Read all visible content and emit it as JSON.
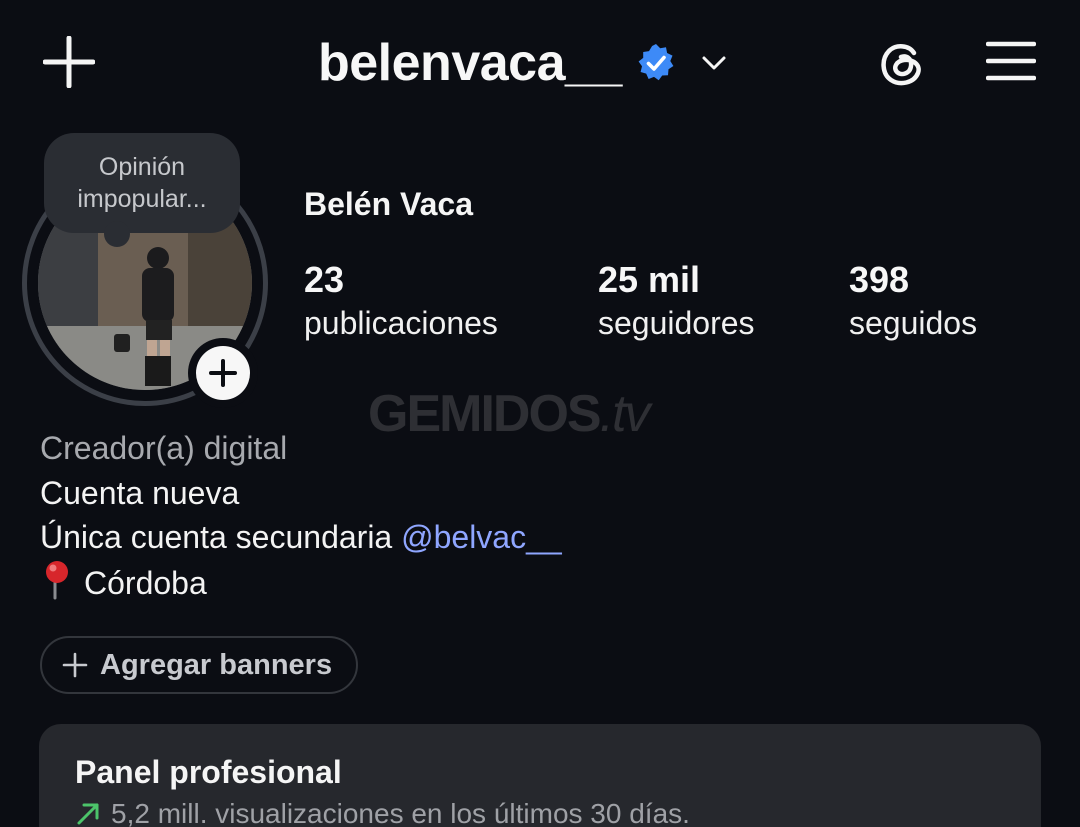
{
  "header": {
    "username": "belenvaca__",
    "icons": {
      "add": "plus-icon",
      "verified": "verified-badge-icon",
      "dropdown": "chevron-down-icon",
      "threads": "threads-icon",
      "menu": "hamburger-menu-icon"
    }
  },
  "note": {
    "text": "Opinión impopular..."
  },
  "profile": {
    "full_name": "Belén Vaca",
    "stats": [
      {
        "value": "23",
        "label": "publicaciones"
      },
      {
        "value": "25 mil",
        "label": "seguidores"
      },
      {
        "value": "398",
        "label": "seguidos"
      }
    ]
  },
  "watermark": {
    "brand": "GEMIDOS",
    "suffix": ".tv"
  },
  "bio": {
    "category": "Creador(a) digital",
    "line1": "Cuenta nueva",
    "line2_prefix": "Única cuenta secundaria ",
    "line2_mention": "@belvac__",
    "location": "Córdoba",
    "location_icon": "pushpin-icon"
  },
  "banner_button": {
    "label": "Agregar banners"
  },
  "panel": {
    "title": "Panel profesional",
    "subtitle": "5,2 mill. visualizaciones en los últimos 30 días."
  },
  "colors": {
    "background": "#0b0d13",
    "verified": "#3d8af7",
    "mention": "#8fa6ff",
    "trend": "#4cc46a",
    "panel": "#26282d"
  }
}
